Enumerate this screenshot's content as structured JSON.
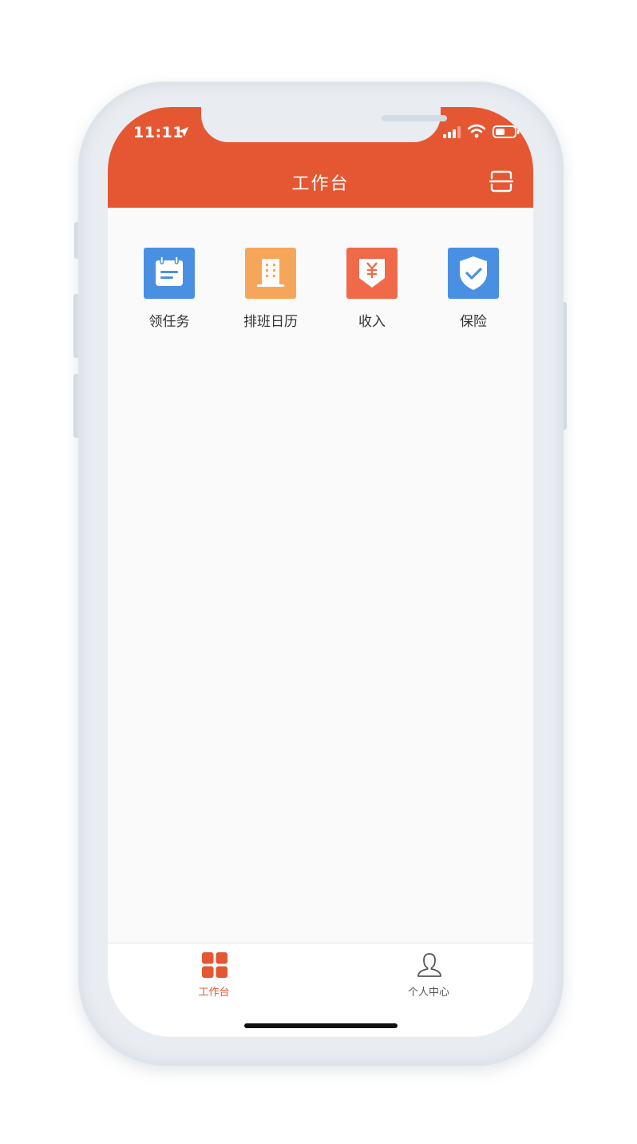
{
  "status_bar": {
    "time": "11:11"
  },
  "header": {
    "title": "工作台",
    "right_icon": "scan-icon"
  },
  "apps": [
    {
      "label": "领任务",
      "icon": "task-calendar-icon",
      "color": "#4a90e2"
    },
    {
      "label": "排班日历",
      "icon": "building-icon",
      "color": "#f5a65b"
    },
    {
      "label": "收入",
      "icon": "income-yuan-icon",
      "color": "#f06a4a"
    },
    {
      "label": "保险",
      "icon": "insurance-shield-icon",
      "color": "#4a90e2"
    }
  ],
  "tabbar": {
    "tabs": [
      {
        "label": "工作台",
        "icon": "grid-icon",
        "active": true
      },
      {
        "label": "个人中心",
        "icon": "person-icon",
        "active": false
      }
    ]
  },
  "colors": {
    "accent": "#e55732",
    "background": "#fafafa"
  }
}
